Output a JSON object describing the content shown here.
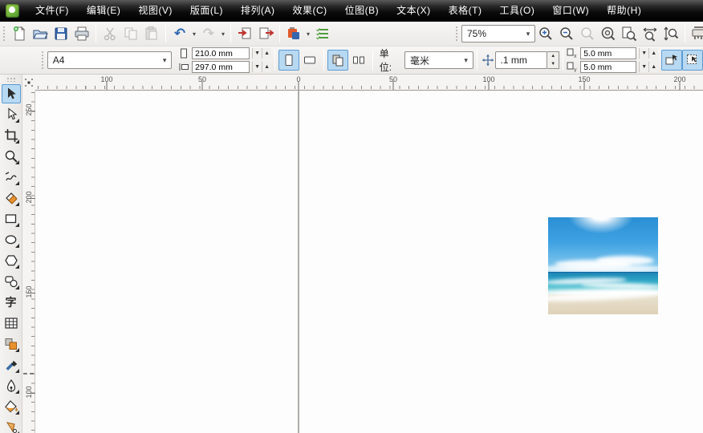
{
  "menu_bar": {
    "items": [
      "文件(F)",
      "编辑(E)",
      "视图(V)",
      "版面(L)",
      "排列(A)",
      "效果(C)",
      "位图(B)",
      "文本(X)",
      "表格(T)",
      "工具(O)",
      "窗口(W)",
      "帮助(H)"
    ]
  },
  "standard_toolbar": {
    "zoom_level": "75%",
    "buttons": [
      {
        "icon": "new-document-icon",
        "enabled": true
      },
      {
        "icon": "open-folder-icon",
        "enabled": true
      },
      {
        "icon": "save-icon",
        "enabled": true
      },
      {
        "icon": "print-icon",
        "enabled": true
      },
      {
        "icon": "cut-icon",
        "enabled": false
      },
      {
        "icon": "copy-icon",
        "enabled": false
      },
      {
        "icon": "paste-icon",
        "enabled": false
      },
      {
        "icon": "undo-icon",
        "enabled": true
      },
      {
        "icon": "redo-icon",
        "enabled": false
      },
      {
        "icon": "import-icon",
        "enabled": true
      },
      {
        "icon": "export-icon",
        "enabled": true
      },
      {
        "icon": "app-launcher-icon",
        "enabled": true
      },
      {
        "icon": "options-list-icon",
        "enabled": true
      },
      {
        "icon": "zoom-in-icon",
        "enabled": true
      },
      {
        "icon": "zoom-out-icon",
        "enabled": true
      },
      {
        "icon": "zoom-selected-icon",
        "enabled": false
      },
      {
        "icon": "zoom-all-icon",
        "enabled": true
      },
      {
        "icon": "zoom-page-icon",
        "enabled": true
      },
      {
        "icon": "zoom-width-icon",
        "enabled": true
      },
      {
        "icon": "zoom-height-icon",
        "enabled": true
      },
      {
        "icon": "snap-drawer-icon",
        "enabled": true
      }
    ],
    "undo_glyph": "↶",
    "redo_glyph": "↷",
    "dropdown_glyph": "▾"
  },
  "property_bar": {
    "paper_size_value": "A4",
    "paper_width_value": "210.0 mm",
    "paper_height_value": "297.0 mm",
    "orientation_selected": "portrait",
    "page_scope_selected": "all-pages",
    "units_label": "单位:",
    "units_value": "毫米",
    "nudge_offset_value": ".1 mm",
    "duplicate_distance_x": "5.0 mm",
    "duplicate_distance_y": "5.0 mm",
    "dup_x_sub": "x",
    "dup_y_sub": "y"
  },
  "rulers": {
    "top_labels": [
      "100",
      "50",
      "0",
      "50",
      "100",
      "150",
      "200"
    ],
    "left_labels": [
      "250",
      "200",
      "150",
      "100"
    ]
  },
  "toolbox": {
    "selected_tool": "pick-tool",
    "text_tool_glyph": "字",
    "tools": [
      "pick-tool",
      "shape-tool",
      "crop-tool",
      "zoom-tool",
      "freehand-tool",
      "smart-fill-tool",
      "rectangle-tool",
      "ellipse-tool",
      "polygon-tool",
      "basic-shapes-tool",
      "text-tool",
      "table-tool",
      "interactive-blend-tool",
      "eyedropper-tool",
      "outline-pen-tool",
      "fill-tool",
      "interactive-fill-tool"
    ]
  },
  "canvas": {
    "objects": [
      {
        "type": "image",
        "description": "beach photo: blue sky with sun glare, white clouds over horizon, turquoise sea with surf foam, sandy shore"
      }
    ]
  },
  "colors": {
    "menubar_bg": "#000000",
    "toolbar_bg": "#f0eeec",
    "selection_highlight": "#b8d9f2",
    "selection_border": "#5b9bd5",
    "undo_blue": "#2f66b0",
    "sky_blue": "#2a8fd4",
    "sea_teal": "#2aa2c4",
    "sand": "#e3d9c2"
  }
}
